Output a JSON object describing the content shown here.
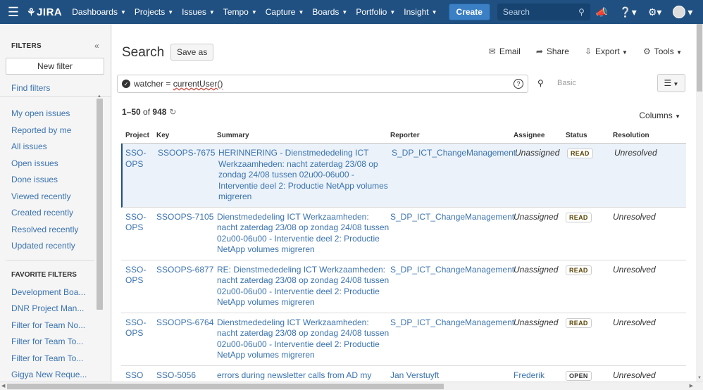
{
  "nav": {
    "logo": "JIRA",
    "items": [
      {
        "label": "Dashboards"
      },
      {
        "label": "Projects"
      },
      {
        "label": "Issues"
      },
      {
        "label": "Tempo"
      },
      {
        "label": "Capture"
      },
      {
        "label": "Boards"
      },
      {
        "label": "Portfolio"
      },
      {
        "label": "Insight"
      }
    ],
    "create_label": "Create",
    "search_placeholder": "Search"
  },
  "sidebar": {
    "header": "FILTERS",
    "new_filter": "New filter",
    "find_filters": "Find filters",
    "links": [
      {
        "label": "My open issues"
      },
      {
        "label": "Reported by me"
      },
      {
        "label": "All issues"
      },
      {
        "label": "Open issues"
      },
      {
        "label": "Done issues"
      },
      {
        "label": "Viewed recently"
      },
      {
        "label": "Created recently"
      },
      {
        "label": "Resolved recently"
      },
      {
        "label": "Updated recently"
      }
    ],
    "favorites_header": "FAVORITE FILTERS",
    "favorites": [
      {
        "label": "Development Boa..."
      },
      {
        "label": "DNR Project Man..."
      },
      {
        "label": "Filter for Team No..."
      },
      {
        "label": "Filter for Team To..."
      },
      {
        "label": "Filter for Team To..."
      },
      {
        "label": "Gigya New Reque..."
      }
    ]
  },
  "main": {
    "title": "Search",
    "save_as": "Save as",
    "toolbar": {
      "email": "Email",
      "share": "Share",
      "export": "Export",
      "tools": "Tools"
    },
    "jql_prefix": "watcher = ",
    "jql_fn": "currentUser()",
    "basic": "Basic",
    "count_range": "1–50",
    "count_of": " of ",
    "count_total": "948",
    "columns_label": "Columns",
    "headers": {
      "project": "Project",
      "key": "Key",
      "summary": "Summary",
      "reporter": "Reporter",
      "assignee": "Assignee",
      "status": "Status",
      "resolution": "Resolution"
    },
    "rows": [
      {
        "project": "SSO-OPS",
        "key": "SSOOPS-7675",
        "summary": "HERINNERING - Dienstmededeling ICT Werkzaamheden: nacht zaterdag 23/08 op zondag 24/08 tussen 02u00-06u00 - Interventie deel 2: Productie NetApp volumes migreren",
        "reporter": "S_DP_ICT_ChangeManagement",
        "assignee": "Unassigned",
        "status": "READ",
        "resolution": "Unresolved"
      },
      {
        "project": "SSO-OPS",
        "key": "SSOOPS-7105",
        "summary": "Dienstmededeling ICT Werkzaamheden: nacht zaterdag 23/08 op zondag 24/08 tussen 02u00-06u00 - Interventie deel 2: Productie NetApp volumes migreren",
        "reporter": "S_DP_ICT_ChangeManagement",
        "assignee": "Unassigned",
        "status": "READ",
        "resolution": "Unresolved"
      },
      {
        "project": "SSO-OPS",
        "key": "SSOOPS-6877",
        "summary": "RE: Dienstmededeling ICT Werkzaamheden: nacht zaterdag 23/08 op zondag 24/08 tussen 02u00-06u00 - Interventie deel 2: Productie NetApp volumes migreren",
        "reporter": "S_DP_ICT_ChangeManagement",
        "assignee": "Unassigned",
        "status": "READ",
        "resolution": "Unresolved"
      },
      {
        "project": "SSO-OPS",
        "key": "SSOOPS-6764",
        "summary": "Dienstmededeling ICT Werkzaamheden: nacht zaterdag 23/08 op zondag 24/08 tussen 02u00-06u00 - Interventie deel 2: Productie NetApp volumes migreren",
        "reporter": "S_DP_ICT_ChangeManagement",
        "assignee": "Unassigned",
        "status": "READ",
        "resolution": "Unresolved"
      },
      {
        "project": "SSO",
        "key": "SSO-5056",
        "summary": "errors during newsletter calls from AD my account",
        "reporter": "Jan Verstuyft",
        "assignee": "Frederik Bracke",
        "status": "OPEN",
        "resolution": "Unresolved"
      }
    ]
  },
  "colors": {
    "nav_bg": "#205081",
    "link": "#3b73af",
    "create": "#3b7fc4"
  }
}
